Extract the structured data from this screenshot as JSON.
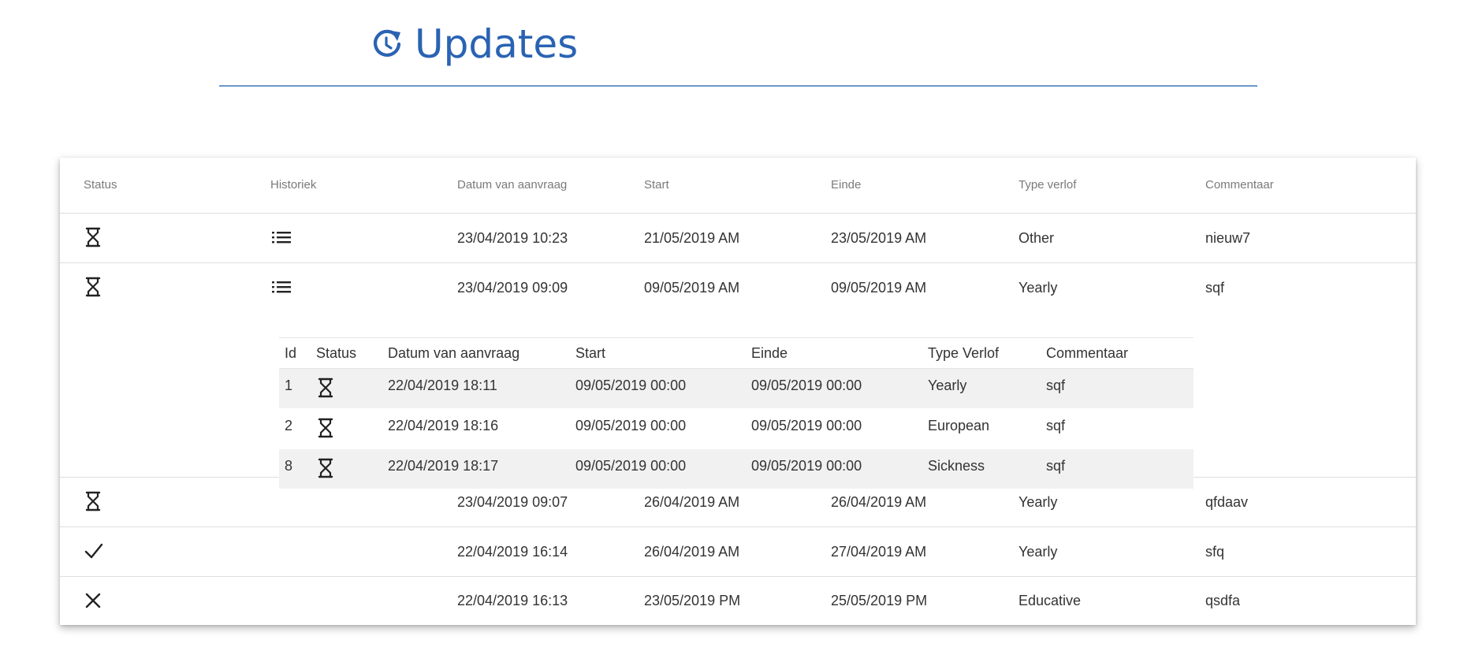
{
  "page": {
    "title": "Updates",
    "title_icon": "history-refresh-icon",
    "accent_color": "#2a63b3"
  },
  "table": {
    "headers": {
      "status": "Status",
      "historiek": "Historiek",
      "datum": "Datum van aanvraag",
      "start": "Start",
      "einde": "Einde",
      "type": "Type verlof",
      "commentaar": "Commentaar"
    },
    "rows": [
      {
        "status_icon": "hourglass-icon",
        "history_icon": "list-icon",
        "datum": "23/04/2019 10:23",
        "start": "21/05/2019 AM",
        "einde": "23/05/2019 AM",
        "type": "Other",
        "commentaar": "nieuw7"
      },
      {
        "status_icon": "hourglass-icon",
        "history_icon": "list-icon",
        "datum": "23/04/2019 09:09",
        "start": "09/05/2019 AM",
        "einde": "09/05/2019 AM",
        "type": "Yearly",
        "commentaar": "sqf"
      },
      {
        "status_icon": "hourglass-icon",
        "history_icon": "",
        "datum": "23/04/2019 09:07",
        "start": "26/04/2019 AM",
        "einde": "26/04/2019 AM",
        "type": "Yearly",
        "commentaar": "qfdaav"
      },
      {
        "status_icon": "check-icon",
        "history_icon": "",
        "datum": "22/04/2019 16:14",
        "start": "26/04/2019 AM",
        "einde": "27/04/2019 AM",
        "type": "Yearly",
        "commentaar": "sfq"
      },
      {
        "status_icon": "close-icon",
        "history_icon": "",
        "datum": "22/04/2019 16:13",
        "start": "23/05/2019 PM",
        "einde": "25/05/2019 PM",
        "type": "Educative",
        "commentaar": "qsdfa"
      }
    ]
  },
  "history": {
    "headers": {
      "id": "Id",
      "status": "Status",
      "datum": "Datum van aanvraag",
      "start": "Start",
      "einde": "Einde",
      "type": "Type Verlof",
      "commentaar": "Commentaar"
    },
    "rows": [
      {
        "id": "1",
        "status_icon": "hourglass-icon",
        "datum": "22/04/2019 18:11",
        "start": "09/05/2019 00:00",
        "einde": "09/05/2019 00:00",
        "type": "Yearly",
        "commentaar": "sqf"
      },
      {
        "id": "2",
        "status_icon": "hourglass-icon",
        "datum": "22/04/2019 18:16",
        "start": "09/05/2019 00:00",
        "einde": "09/05/2019 00:00",
        "type": "European",
        "commentaar": "sqf"
      },
      {
        "id": "8",
        "status_icon": "hourglass-icon",
        "datum": "22/04/2019 18:17",
        "start": "09/05/2019 00:00",
        "einde": "09/05/2019 00:00",
        "type": "Sickness",
        "commentaar": "sqf"
      }
    ]
  }
}
